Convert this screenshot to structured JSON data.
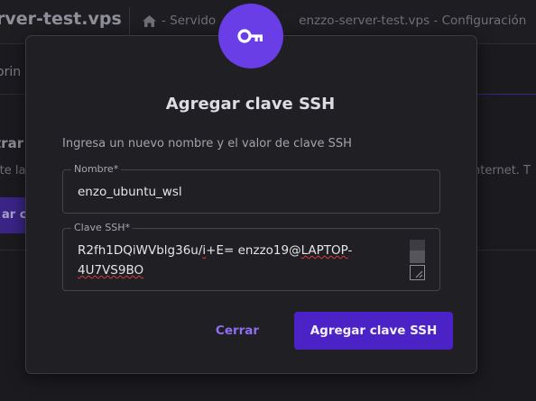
{
  "background": {
    "server_title": "rver-test.vps",
    "breadcrumb": "-  Servido",
    "breadcrumb_tail": "enzzo-server-test.vps - Configuración",
    "tab_partial": "orin",
    "section_partial": "trar",
    "sub_partial": "ite la",
    "right_partial": "nternet. T",
    "button_partial": "ar cl"
  },
  "modal": {
    "icon": "key-icon",
    "title": "Agregar clave SSH",
    "description": "Ingresa un nuevo nombre y el valor de clave SSH",
    "name_field": {
      "label": "Nombre*",
      "value": "enzo_ubuntu_wsl"
    },
    "key_field": {
      "label": "Clave SSH*",
      "value_line1_a": "R2fh1DQiWVblg36u/",
      "value_line1_b": "i",
      "value_line1_c": "+E= enzzo19@",
      "value_line1_d": "LAPTOP",
      "value_line1_e": "-",
      "value_line2": "4U7VS9BO"
    },
    "cancel_label": "Cerrar",
    "submit_label": "Agregar clave SSH"
  },
  "colors": {
    "accent": "#6a3ee6",
    "button": "#4b22c5",
    "link": "#8f6cf0"
  }
}
